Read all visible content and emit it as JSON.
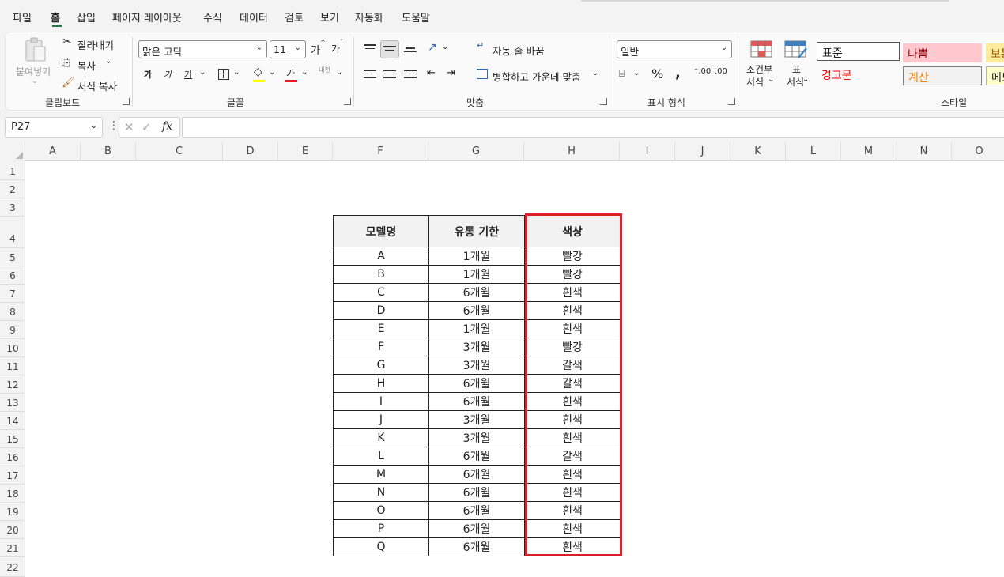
{
  "menu": [
    "파일",
    "홈",
    "삽입",
    "페이지 레이아웃",
    "수식",
    "데이터",
    "검토",
    "보기",
    "자동화",
    "도움말"
  ],
  "ribbon": {
    "clipboard": {
      "paste": "붙여넣기",
      "cut": "잘라내기",
      "copy": "복사",
      "format_painter": "서식 복사",
      "label": "클립보드"
    },
    "font": {
      "font_name": "맑은 고딕",
      "font_size": "11",
      "grow": "가",
      "shrink": "가",
      "bold": "가",
      "italic": "가",
      "underline": "가",
      "font_color_glyph": "가",
      "phonetic": "내천",
      "label": "글꼴"
    },
    "alignment": {
      "wrap_text": "자동 줄 바꿈",
      "merge_center": "병합하고 가운데 맞춤",
      "label": "맞춤"
    },
    "number": {
      "format": "일반",
      "label": "표시 형식"
    },
    "styles": {
      "conditional": "조건부",
      "conditional2": "서식",
      "table": "표",
      "table2": "서식",
      "standard": "표준",
      "bad": "나쁨",
      "good": "보통",
      "warning": "경고문",
      "calculation": "계산",
      "memo": "메모",
      "label": "스타일"
    }
  },
  "formula_bar": {
    "name_box": "P27",
    "fx": "fx",
    "formula": ""
  },
  "columns": [
    "A",
    "B",
    "C",
    "D",
    "E",
    "F",
    "G",
    "H",
    "I",
    "J",
    "K",
    "L",
    "M",
    "N",
    "O"
  ],
  "rows": [
    "1",
    "2",
    "3",
    "4",
    "5",
    "6",
    "7",
    "8",
    "9",
    "10",
    "11",
    "12",
    "13",
    "14",
    "15",
    "16",
    "17",
    "18",
    "19",
    "20",
    "21",
    "22"
  ],
  "table": {
    "headers": [
      "모델명",
      "유통 기한",
      "색상"
    ],
    "rows": [
      [
        "A",
        "1개월",
        "빨강"
      ],
      [
        "B",
        "1개월",
        "빨강"
      ],
      [
        "C",
        "6개월",
        "흰색"
      ],
      [
        "D",
        "6개월",
        "흰색"
      ],
      [
        "E",
        "1개월",
        "흰색"
      ],
      [
        "F",
        "3개월",
        "빨강"
      ],
      [
        "G",
        "3개월",
        "갈색"
      ],
      [
        "H",
        "6개월",
        "갈색"
      ],
      [
        "I",
        "6개월",
        "흰색"
      ],
      [
        "J",
        "3개월",
        "흰색"
      ],
      [
        "K",
        "3개월",
        "흰색"
      ],
      [
        "L",
        "6개월",
        "갈색"
      ],
      [
        "M",
        "6개월",
        "흰색"
      ],
      [
        "N",
        "6개월",
        "흰색"
      ],
      [
        "O",
        "6개월",
        "흰색"
      ],
      [
        "P",
        "6개월",
        "흰색"
      ],
      [
        "Q",
        "6개월",
        "흰색"
      ]
    ]
  },
  "colors": {
    "accent": "#217346",
    "highlight": "#e01c24",
    "bad_bg": "#ffc7ce",
    "bad_text": "#9c0006",
    "warning_text": "#ff0000",
    "calc_text": "#fa7d00",
    "neutral_bg": "#ffeb9c"
  }
}
